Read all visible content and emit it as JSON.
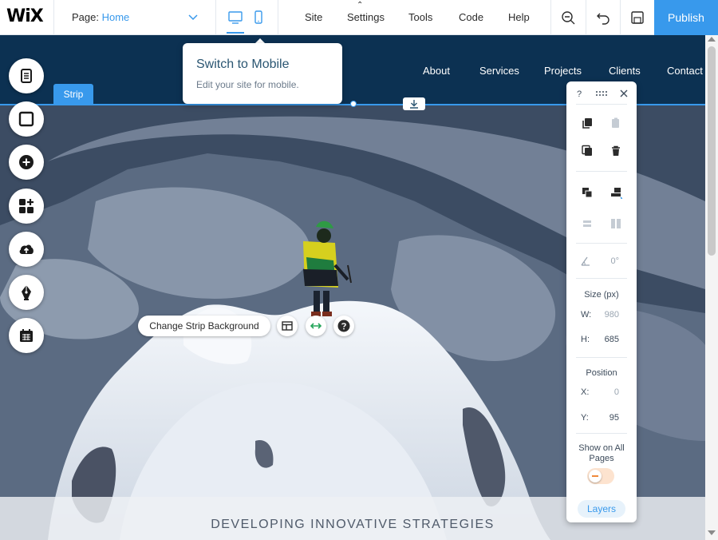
{
  "topbar": {
    "logo": "WiX",
    "page_label": "Page:",
    "page_value": "Home",
    "menu": {
      "site": "Site",
      "settings": "Settings",
      "tools": "Tools",
      "code": "Code",
      "help": "Help"
    },
    "publish": "Publish",
    "icons": [
      "chevron-down-icon",
      "desktop-icon",
      "mobile-icon",
      "zoom-out-icon",
      "undo-icon",
      "save-icon"
    ]
  },
  "site": {
    "nav": [
      "About",
      "Services",
      "Projects",
      "Clients",
      "Contact"
    ],
    "strip_label": "Strip",
    "footer_text": "DEVELOPING INNOVATIVE STRATEGIES"
  },
  "left_tools": [
    "pages-icon",
    "background-icon",
    "add-icon",
    "app-market-icon",
    "upload-icon",
    "blog-pen-icon",
    "bookings-icon"
  ],
  "tooltip": {
    "title": "Switch to Mobile",
    "subtitle": "Edit your site for mobile."
  },
  "strip_actions": {
    "change_background": "Change Strip Background",
    "icons": [
      "layout-icon",
      "stretch-icon",
      "help-icon"
    ]
  },
  "panel": {
    "header_icons": [
      "help-icon",
      "drag-handle-icon",
      "close-icon"
    ],
    "rotation": "0°",
    "size_label": "Size (px)",
    "w_key": "W:",
    "w_val": "980",
    "h_key": "H:",
    "h_val": "685",
    "position_label": "Position",
    "x_key": "X:",
    "x_val": "0",
    "y_key": "Y:",
    "y_val": "95",
    "show_all_label": "Show on All Pages",
    "show_all_on": false,
    "layers": "Layers"
  },
  "colors": {
    "accent": "#3899ec",
    "site_header": "#0c3152"
  }
}
